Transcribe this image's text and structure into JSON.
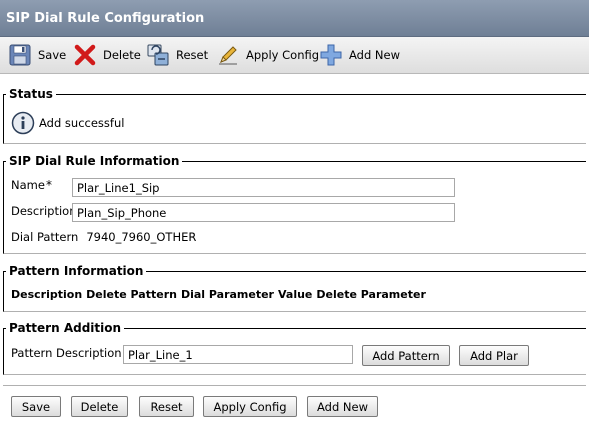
{
  "window": {
    "title": "SIP Dial Rule Configuration"
  },
  "toolbar": {
    "save": "Save",
    "delete": "Delete",
    "reset": "Reset",
    "apply": "Apply Config",
    "add_new": "Add New"
  },
  "status": {
    "legend": "Status",
    "message": "Add successful"
  },
  "info": {
    "legend": "SIP Dial Rule Information",
    "name_label": "Name",
    "required_mark": "*",
    "name_value": "Plar_Line1_Sip",
    "description_label": "Description",
    "description_value": "Plan_Sip_Phone",
    "dial_pattern_label": "Dial Pattern",
    "dial_pattern_value": "7940_7960_OTHER"
  },
  "pattern_info": {
    "legend": "Pattern Information",
    "columns": [
      "Description",
      "Delete Pattern",
      "Dial Parameter",
      "Value",
      "Delete Parameter"
    ]
  },
  "pattern_addition": {
    "legend": "Pattern Addition",
    "label": "Pattern Description",
    "value": "Plar_Line_1",
    "add_pattern": "Add Pattern",
    "add_plar": "Add Plar"
  },
  "bottom_buttons": {
    "save": "Save",
    "delete": "Delete",
    "reset": "Reset",
    "apply": "Apply Config",
    "add_new": "Add New"
  },
  "icons": {
    "save": "floppy-disk-icon",
    "delete": "red-x-icon",
    "reset": "reset-icon",
    "apply": "pencil-icon",
    "add_new": "plus-icon",
    "status": "info-icon"
  },
  "colors": {
    "title_bar": "#7d8ca2",
    "delete_red": "#d11a1a",
    "add_blue": "#4a7fd0"
  }
}
